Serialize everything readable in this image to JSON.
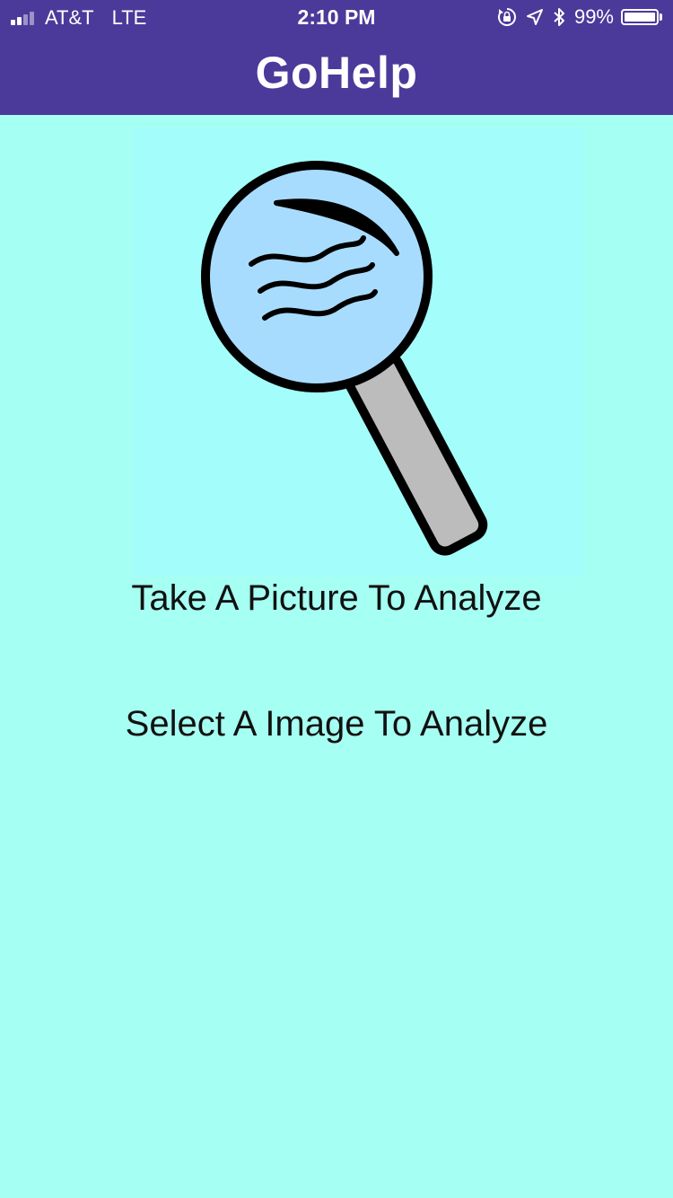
{
  "status_bar": {
    "carrier": "AT&T",
    "network": "LTE",
    "time": "2:10 PM",
    "battery_percent": "99%",
    "battery_level": 0.99,
    "signal_bars_filled": 2,
    "signal_bars_total": 4,
    "icons": [
      "signal-icon",
      "orientation-lock-icon",
      "location-arrow-icon",
      "bluetooth-icon",
      "battery-icon"
    ]
  },
  "header": {
    "title": "GoHelp",
    "background_color": "#4b3a9a"
  },
  "logo": {
    "icon": "magnifying-glass-icon"
  },
  "actions": {
    "take_picture_label": "Take A Picture To Analyze",
    "select_image_label": "Select A Image To Analyze"
  },
  "colors": {
    "background": "#a6fff3",
    "lens": "#a8dcff",
    "handle": "#bcbcbc"
  }
}
